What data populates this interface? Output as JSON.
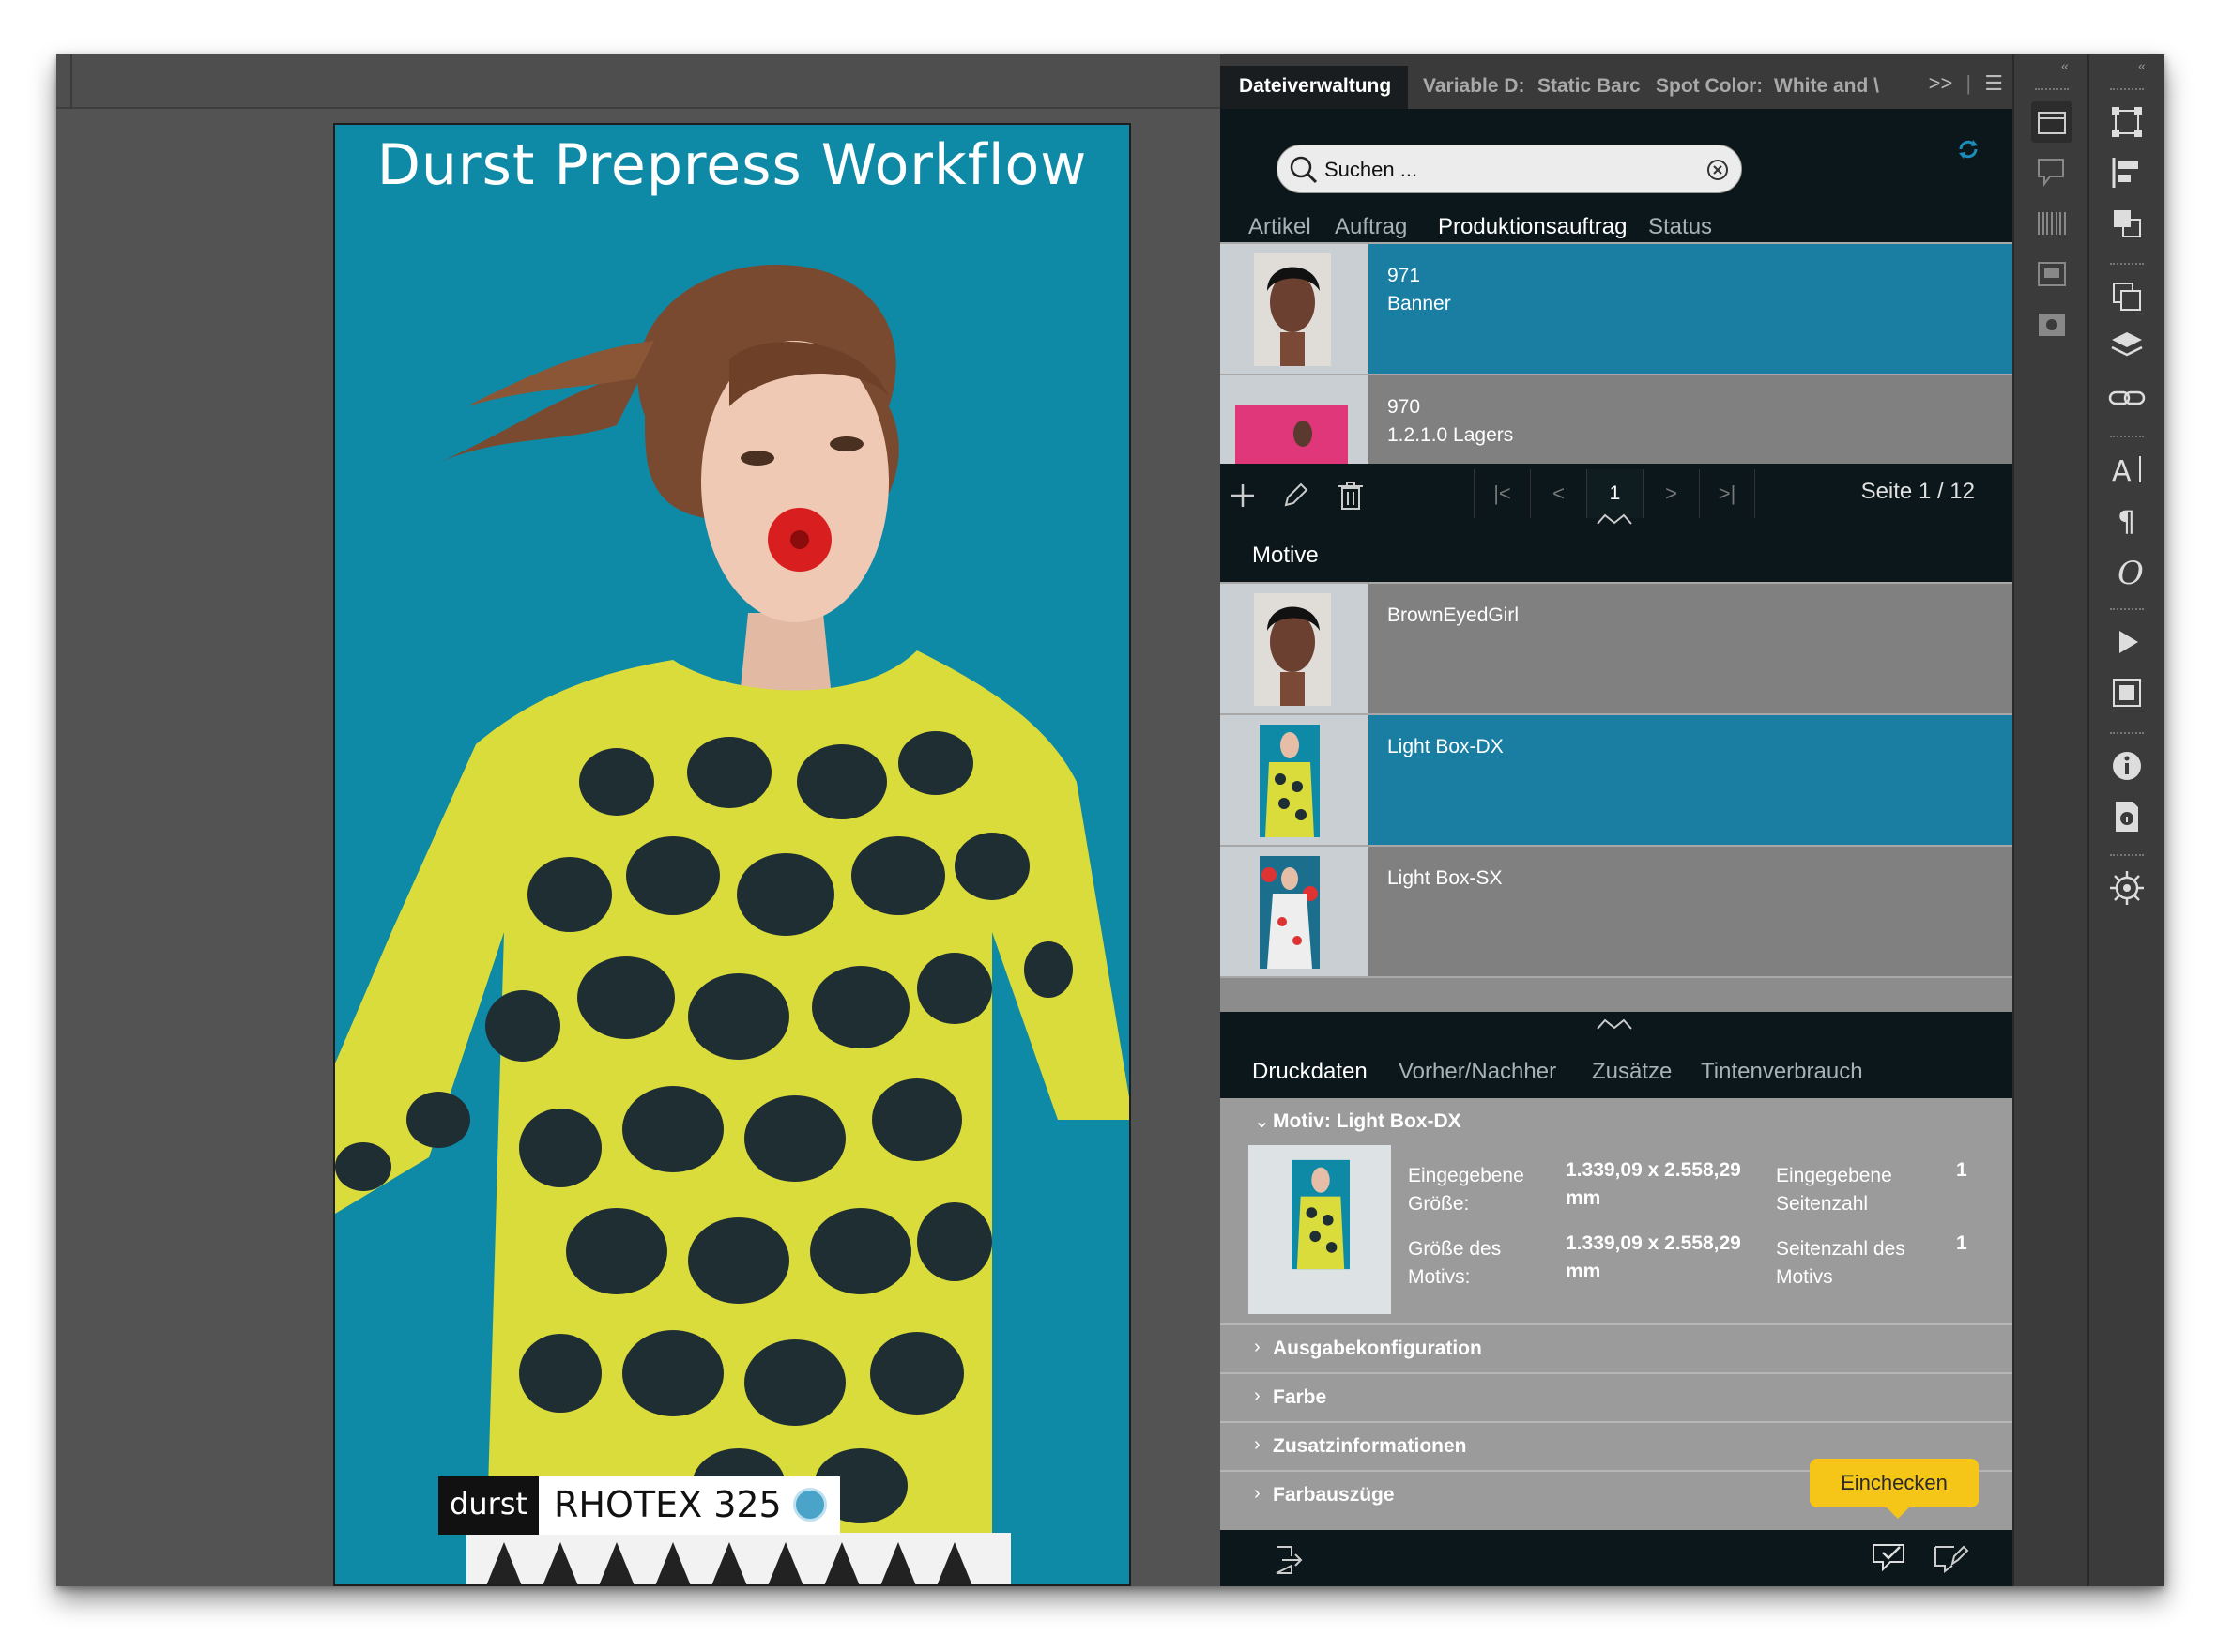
{
  "document": {
    "title": "Durst Prepress Workflow",
    "brand": "durst",
    "product": "RHOTEX 325"
  },
  "panel": {
    "tabs": [
      "Dateiverwaltung",
      "Variable D:",
      "Static Barc",
      "Spot Color:",
      "White and \\"
    ],
    "tab_overflow": ">>",
    "search": {
      "placeholder": "Suchen ..."
    },
    "subtabs": [
      "Artikel",
      "Auftrag",
      "Produktionsauftrag",
      "Status"
    ],
    "jobs": [
      {
        "id": "971",
        "name": "Banner"
      },
      {
        "id": "970",
        "name": "1.2.1.0 Lagers"
      }
    ],
    "pager": {
      "current": "1",
      "page_label": "Seite 1 / 12"
    },
    "motive_label": "Motive",
    "motives": [
      {
        "name": "BrownEyedGirl"
      },
      {
        "name": "Light Box-DX"
      },
      {
        "name": "Light Box-SX"
      }
    ],
    "detail_tabs": [
      "Druckdaten",
      "Vorher/Nachher",
      "Zusätze",
      "Tintenverbrauch"
    ],
    "motif": {
      "title": "Motiv: Light Box-DX",
      "entered_size_label": "Eingegebene Größe:",
      "entered_size_value": "1.339,09 x 2.558,29 mm",
      "motif_size_label": "Größe des Motivs:",
      "motif_size_value": "1.339,09 x 2.558,29 mm",
      "entered_pages_label": "Eingegebene Seitenzahl",
      "entered_pages_value": "1",
      "motif_pages_label": "Seitenzahl des Motivs",
      "motif_pages_value": "1"
    },
    "sections": [
      "Ausgabekonfiguration",
      "Farbe",
      "Zusatzinformationen",
      "Farbauszüge"
    ],
    "tooltip": "Einchecken"
  },
  "colors": {
    "accent": "#197ea1",
    "background_teal": "#0f8aa6",
    "tooltip": "#f5c518",
    "dress_yellow": "#d9dc3a",
    "dot_dark": "#1f2e33"
  }
}
